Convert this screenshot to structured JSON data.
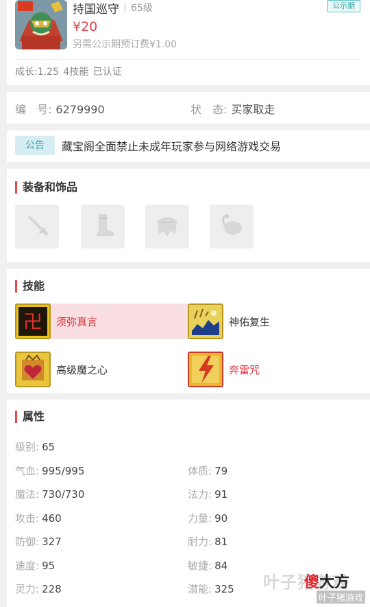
{
  "product": {
    "title": "持国巡守",
    "level": "65级",
    "badge": "公示期",
    "price": "¥20",
    "deposit_note": "另需公示期预订费¥1.00",
    "meta": "成长:1.25  4技能  已认证"
  },
  "info": {
    "serial_label": "编　号:",
    "serial_value": "6279990",
    "status_label": "状　态:",
    "status_value": "买家取走"
  },
  "notice": {
    "tag": "公告",
    "text": "藏宝阁全面禁止未成年玩家参与网络游戏交易"
  },
  "equipment": {
    "title": "装备和饰品",
    "slots": [
      "weapon-slot-icon",
      "boots-slot-icon",
      "armor-slot-icon",
      "accessory-slot-icon"
    ]
  },
  "skills": {
    "title": "技能",
    "items": [
      {
        "name": "须弥真言",
        "selected": true
      },
      {
        "name": "神佑复生",
        "selected": false
      },
      {
        "name": "高级魔之心",
        "selected": false
      },
      {
        "name": "奔雷咒",
        "selected": false
      }
    ]
  },
  "attributes": {
    "title": "属性",
    "rows": [
      {
        "k": "级别:",
        "v": "65"
      },
      {
        "k": "气血:",
        "v": "995/995"
      },
      {
        "k": "体质:",
        "v": "79"
      },
      {
        "k": "魔法:",
        "v": "730/730"
      },
      {
        "k": "法力:",
        "v": "91"
      },
      {
        "k": "攻击:",
        "v": "460"
      },
      {
        "k": "力量:",
        "v": "90"
      },
      {
        "k": "防御:",
        "v": "327"
      },
      {
        "k": "耐力:",
        "v": "81"
      },
      {
        "k": "速度:",
        "v": "95"
      },
      {
        "k": "敏捷:",
        "v": "84"
      },
      {
        "k": "灵力:",
        "v": "228"
      },
      {
        "k": "潜能:",
        "v": "325"
      }
    ]
  },
  "watermark": {
    "bg": "叶子猪游戏",
    "main_prefix": "傻",
    "main_suffix": "大方",
    "sub": "叶子猪游戏"
  },
  "colors": {
    "accent_red": "#e6424b",
    "teal": "#3aa9ac",
    "selected_bg": "#f9dfe1"
  }
}
